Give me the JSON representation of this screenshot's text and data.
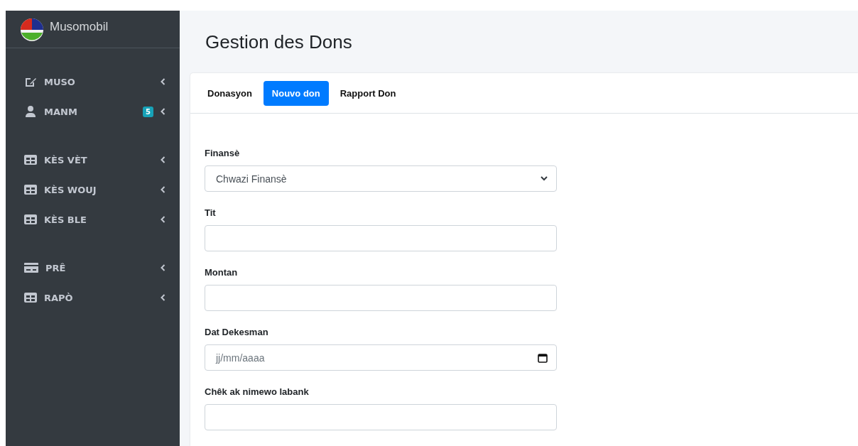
{
  "brand": {
    "name": "Musomobil"
  },
  "sidebar": {
    "groups": [
      {
        "items": [
          {
            "label": "MUSO",
            "kind": "edit"
          },
          {
            "label": "MANM",
            "kind": "user",
            "badge": "5"
          }
        ]
      },
      {
        "items": [
          {
            "label": "KÈS VÈT",
            "kind": "table"
          },
          {
            "label": "KÈS WOUJ",
            "kind": "table"
          },
          {
            "label": "KÈS BLE",
            "kind": "table"
          }
        ]
      },
      {
        "items": [
          {
            "label": "PRÊ",
            "kind": "card"
          },
          {
            "label": "RAPÒ",
            "kind": "table"
          }
        ]
      }
    ]
  },
  "page_title": "Gestion des Dons",
  "tabs": [
    {
      "label": "Donasyon",
      "selected": false
    },
    {
      "label": "Nouvo don",
      "selected": true
    },
    {
      "label": "Rapport Don",
      "selected": false
    }
  ],
  "form": [
    {
      "label": "Finansè",
      "kind": "select",
      "value": "Chwazi Finansè"
    },
    {
      "label": "Tit",
      "kind": "text"
    },
    {
      "label": "Montan",
      "kind": "text"
    },
    {
      "label": "Dat Dekesman",
      "kind": "date",
      "placeholder": "jj/mm/aaaa"
    },
    {
      "label": "Chêk ak nimewo labank",
      "kind": "text"
    }
  ]
}
